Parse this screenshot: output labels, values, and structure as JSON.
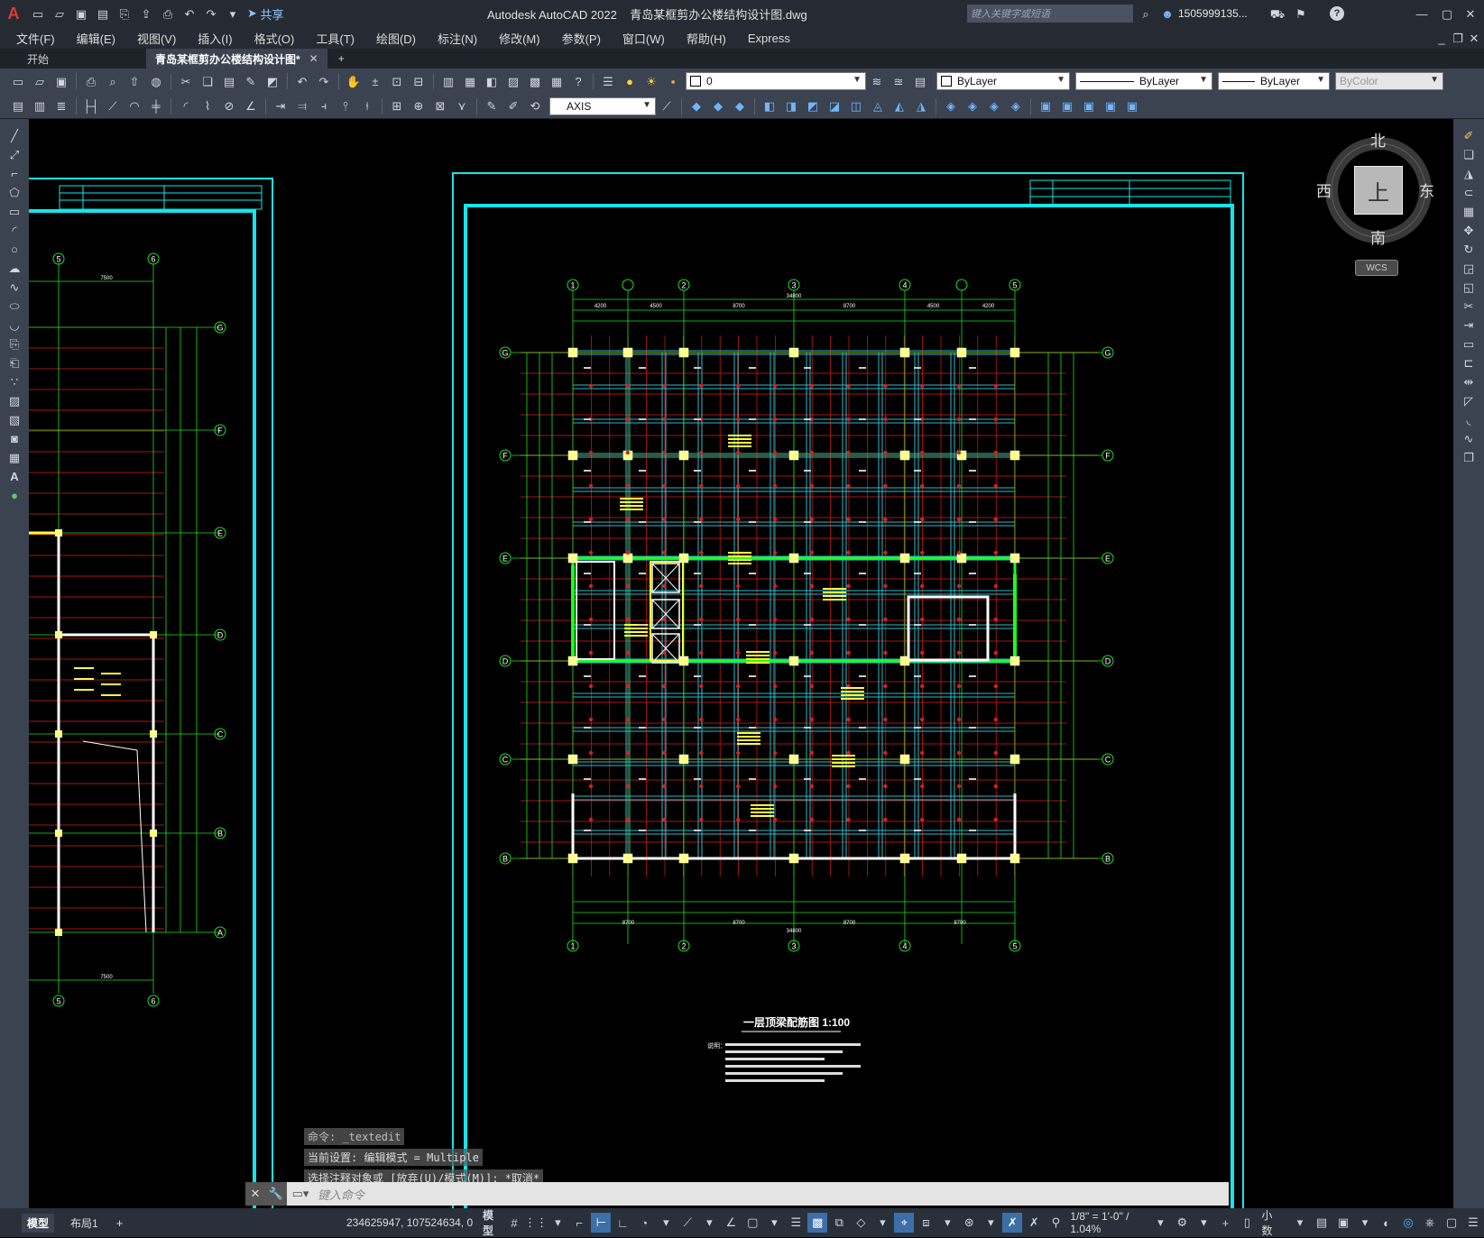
{
  "app": {
    "logo": "A",
    "title": "Autodesk AutoCAD 2022    青岛某框剪办公楼结构设计图.dwg",
    "share_label": "共享",
    "search_placeholder": "键入关键字或短语",
    "user": "1505999135...",
    "help": "?"
  },
  "menu": [
    "文件(F)",
    "编辑(E)",
    "视图(V)",
    "插入(I)",
    "格式(O)",
    "工具(T)",
    "绘图(D)",
    "标注(N)",
    "修改(M)",
    "参数(P)",
    "窗口(W)",
    "帮助(H)",
    "Express"
  ],
  "tabs": [
    {
      "label": "开始"
    },
    {
      "label": "青岛某框剪办公楼结构设计图*"
    }
  ],
  "toolbar": {
    "layer_value": "0",
    "color": "ByLayer",
    "linetype": "ByLayer",
    "lineweight": "ByLayer",
    "plotstyle": "ByColor",
    "dimstyle": "AXIS"
  },
  "viewcube": {
    "north": "北",
    "south": "南",
    "east": "东",
    "west": "西",
    "top": "上",
    "wcs": "WCS"
  },
  "drawing": {
    "plan_title": "一层顶梁配筋图   1:100",
    "axes_numbers": [
      "1",
      "2",
      "3",
      "4",
      "5"
    ],
    "axes_letters": [
      "G",
      "F",
      "E",
      "D",
      "C",
      "B"
    ],
    "left_axes_letters": [
      "G",
      "F",
      "E",
      "D",
      "C",
      "B",
      "A"
    ],
    "left_axes_numbers": [
      "5",
      "6"
    ],
    "dims_top": [
      "4200",
      "4500",
      "8700",
      "8700",
      "4500",
      "4200"
    ],
    "dims_bottom": [
      "8700",
      "8700",
      "8700",
      "8700"
    ],
    "total_width": "34800",
    "left_dim": "7500",
    "notes_label": "说明："
  },
  "command": {
    "history": [
      "命令: _textedit",
      "当前设置: 编辑模式 = Multiple",
      "选择注释对象或 [放弃(U)/模式(M)]: *取消*"
    ],
    "placeholder": "键入命令"
  },
  "status": {
    "layout_tabs": [
      "模型",
      "布局1"
    ],
    "coords": "234625947, 107524634, 0",
    "model_label": "模型",
    "scale": "1/8\" = 1'-0\" / 1.04%",
    "units": "小数"
  }
}
